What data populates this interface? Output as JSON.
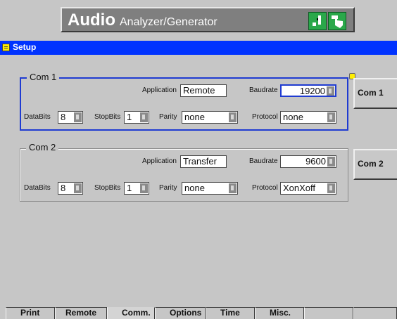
{
  "header": {
    "title_main": "Audio",
    "title_sub": "Analyzer/Generator"
  },
  "setup_bar": {
    "label": "Setup"
  },
  "com1": {
    "legend": "Com 1",
    "application_label": "Application",
    "application_value": "Remote",
    "baudrate_label": "Baudrate",
    "baudrate_value": "19200",
    "databits_label": "DataBits",
    "databits_value": "8",
    "stopbits_label": "StopBits",
    "stopbits_value": "1",
    "parity_label": "Parity",
    "parity_value": "none",
    "protocol_label": "Protocol",
    "protocol_value": "none"
  },
  "com2": {
    "legend": "Com 2",
    "application_label": "Application",
    "application_value": "Transfer",
    "baudrate_label": "Baudrate",
    "baudrate_value": "9600",
    "databits_label": "DataBits",
    "databits_value": "8",
    "stopbits_label": "StopBits",
    "stopbits_value": "1",
    "parity_label": "Parity",
    "parity_value": "none",
    "protocol_label": "Protocol",
    "protocol_value": "XonXoff"
  },
  "side_buttons": {
    "com1": "Com 1",
    "com2": "Com 2"
  },
  "tabs": [
    "Print",
    "Remote",
    "Comm.",
    "Options",
    "Time",
    "Misc.",
    "",
    ""
  ],
  "colors": {
    "accent": "#0033ff",
    "focus": "#1f3bd1",
    "bg": "#c6c6c6"
  }
}
